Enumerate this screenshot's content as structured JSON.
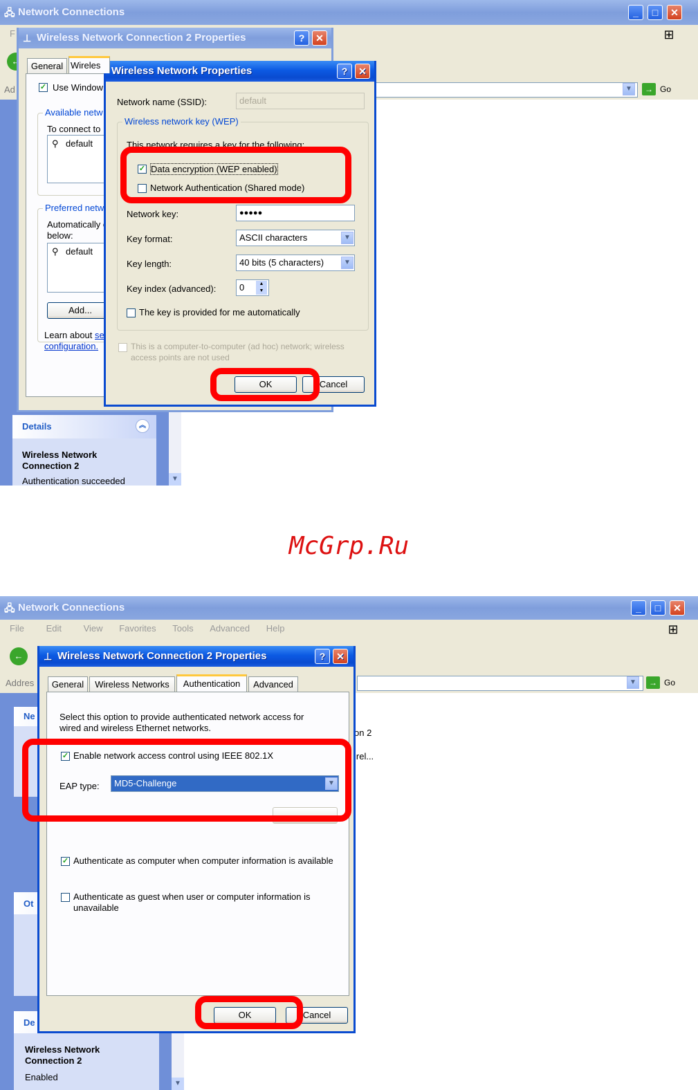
{
  "watermark": "McGrp.Ru",
  "top": {
    "window_title": "Network Connections",
    "menu_first": "F",
    "address_label": "Ad",
    "go_label": "Go",
    "props": {
      "title": "Wireless Network Connection 2 Properties",
      "tab_general": "General",
      "tab_wireless": "Wireles",
      "use_windows": "Use Window",
      "available_label": "Available netw",
      "to_connect": "To connect to",
      "available_item": "default",
      "preferred_label": "Preferred netw",
      "auto_text1": "Automatically c",
      "auto_text2": "below:",
      "preferred_item": "default",
      "add_button": "Add...",
      "learn_about": "Learn about",
      "learn_link": "se",
      "configuration_link": "configuration."
    },
    "wnp": {
      "title": "Wireless Network Properties",
      "ssid_label": "Network name (SSID):",
      "ssid_value": "default",
      "wep_group": "Wireless network key (WEP)",
      "hidden_text": "This network requires a key for the following:",
      "data_encryption": "Data encryption (WEP enabled)",
      "network_auth": "Network Authentication (Shared mode)",
      "key_label": "Network key:",
      "key_value": "●●●●●",
      "format_label": "Key format:",
      "format_value": "ASCII characters",
      "length_label": "Key length:",
      "length_value": "40 bits (5 characters)",
      "index_label": "Key index (advanced):",
      "index_value": "0",
      "auto_key": "The key is provided for me automatically",
      "adhoc_line1": "This is a computer-to-computer (ad hoc) network; wireless",
      "adhoc_line2": "access points are not used",
      "ok": "OK",
      "cancel": "Cancel"
    },
    "details": {
      "header": "Details",
      "name_line1": "Wireless Network",
      "name_line2": "Connection 2",
      "status": "Authentication succeeded"
    }
  },
  "bottom": {
    "window_title": "Network Connections",
    "menu": [
      "File",
      "Edit",
      "View",
      "Favorites",
      "Tools",
      "Advanced",
      "Help"
    ],
    "address_label": "Addres",
    "go_label": "Go",
    "bg_text1": "on 2",
    "bg_text2": "irel...",
    "left_heads": [
      "Ne",
      "Ot",
      "De"
    ],
    "props": {
      "title": "Wireless Network Connection 2 Properties",
      "tabs": [
        "General",
        "Wireless Networks",
        "Authentication",
        "Advanced"
      ],
      "desc_line1": "Select this option to provide authenticated network access for",
      "desc_line2": "wired and wireless Ethernet networks.",
      "enable_8021x": "Enable network access control using IEEE 802.1X",
      "eap_label": "EAP type:",
      "eap_value": "MD5-Challenge",
      "auth_computer": "Authenticate as computer when computer information is available",
      "auth_guest_line1": "Authenticate as guest when user or computer information is",
      "auth_guest_line2": "unavailable",
      "ok": "OK",
      "cancel": "Cancel"
    },
    "details": {
      "name_line1": "Wireless Network",
      "name_line2": "Connection 2",
      "status": "Enabled"
    }
  }
}
